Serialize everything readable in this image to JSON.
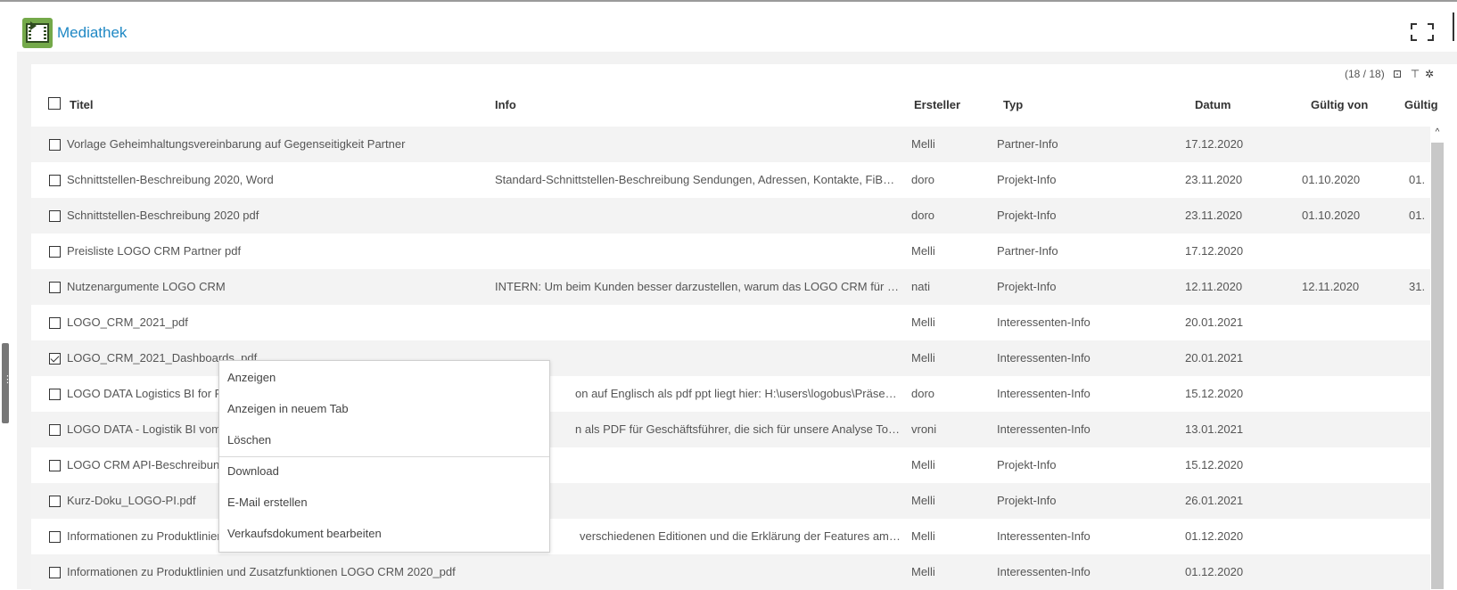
{
  "app": {
    "title": "Mediathek"
  },
  "toolbar": {
    "count": "(18 / 18)"
  },
  "columns": {
    "title": "Titel",
    "info": "Info",
    "creator": "Ersteller",
    "type": "Typ",
    "date": "Datum",
    "valid_from": "Gültig von",
    "valid_to": "Gültig"
  },
  "rows": [
    {
      "title": "Vorlage Geheimhaltungsvereinbarung auf Gegenseitigkeit Partner",
      "info": "",
      "creator": "Melli",
      "type": "Partner-Info",
      "date": "17.12.2020",
      "valid_from": "",
      "valid_to": "",
      "checked": false
    },
    {
      "title": "Schnittstellen-Beschreibung 2020, Word",
      "info": "Standard-Schnittstellen-Beschreibung Sendungen, Adressen, Kontakte, FiBu, Abs/...",
      "creator": "doro",
      "type": "Projekt-Info",
      "date": "23.11.2020",
      "valid_from": "01.10.2020",
      "valid_to": "01.",
      "checked": false
    },
    {
      "title": "Schnittstellen-Beschreibung 2020 pdf",
      "info": "",
      "creator": "doro",
      "type": "Projekt-Info",
      "date": "23.11.2020",
      "valid_from": "01.10.2020",
      "valid_to": "01.",
      "checked": false
    },
    {
      "title": "Preisliste LOGO CRM Partner pdf",
      "info": "",
      "creator": "Melli",
      "type": "Partner-Info",
      "date": "17.12.2020",
      "valid_from": "",
      "valid_to": "",
      "checked": false
    },
    {
      "title": "Nutzenargumente LOGO CRM",
      "info": "INTERN: Um beim Kunden besser darzustellen, warum das LOGO CRM für diesen ...",
      "creator": "nati",
      "type": "Projekt-Info",
      "date": "12.11.2020",
      "valid_from": "12.11.2020",
      "valid_to": "31.",
      "checked": false
    },
    {
      "title": "LOGO_CRM_2021_pdf",
      "info": "",
      "creator": "Melli",
      "type": "Interessenten-Info",
      "date": "20.01.2021",
      "valid_from": "",
      "valid_to": "",
      "checked": false
    },
    {
      "title": "LOGO_CRM_2021_Dashboards_pdf",
      "info": "",
      "creator": "Melli",
      "type": "Interessenten-Info",
      "date": "20.01.2021",
      "valid_from": "",
      "valid_to": "",
      "checked": true
    },
    {
      "title": "LOGO DATA Logistics BI for Pro",
      "info": "on auf Englisch als pdf ppt liegt hier: H:\\users\\logobus\\Präsentationen",
      "creator": "doro",
      "type": "Interessenten-Info",
      "date": "15.12.2020",
      "valid_from": "",
      "valid_to": "",
      "checked": false
    },
    {
      "title": "LOGO DATA - Logistik BI vom F",
      "info": "n als PDF für Geschäftsführer, die sich für unsere Analyse Tools interes...",
      "creator": "vroni",
      "type": "Interessenten-Info",
      "date": "13.01.2021",
      "valid_from": "",
      "valid_to": "",
      "checked": false
    },
    {
      "title": "LOGO CRM API-Beschreibung",
      "info": "",
      "creator": "Melli",
      "type": "Projekt-Info",
      "date": "15.12.2020",
      "valid_from": "",
      "valid_to": "",
      "checked": false
    },
    {
      "title": "Kurz-Doku_LOGO-PI.pdf",
      "info": "",
      "creator": "Melli",
      "type": "Projekt-Info",
      "date": "26.01.2021",
      "valid_from": "",
      "valid_to": "",
      "checked": false
    },
    {
      "title": "Informationen zu Produktlinien",
      "info": "verschiedenen Editionen und die Erklärung der Features am Ende.",
      "creator": "Melli",
      "type": "Interessenten-Info",
      "date": "01.12.2020",
      "valid_from": "",
      "valid_to": "",
      "checked": false
    },
    {
      "title": "Informationen zu Produktlinien und Zusatzfunktionen LOGO CRM 2020_pdf",
      "info": "",
      "creator": "Melli",
      "type": "Interessenten-Info",
      "date": "01.12.2020",
      "valid_from": "",
      "valid_to": "",
      "checked": false
    }
  ],
  "context_menu": {
    "items": [
      "Anzeigen",
      "Anzeigen in neuem Tab",
      "Löschen",
      "Download",
      "E-Mail erstellen",
      "Verkaufsdokument bearbeiten"
    ]
  }
}
